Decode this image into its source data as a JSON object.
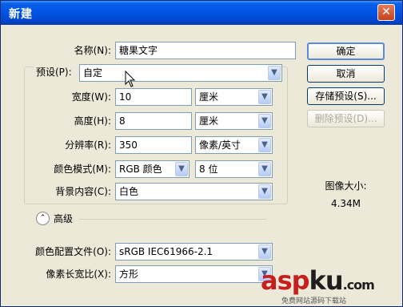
{
  "window": {
    "title": "新建",
    "close_glyph": "✕"
  },
  "form": {
    "name_label": "名称(N):",
    "name_value": "糖果文字",
    "preset_label": "预设(P):",
    "preset_value": "自定",
    "width_label": "宽度(W):",
    "width_value": "10",
    "width_unit": "厘米",
    "height_label": "高度(H):",
    "height_value": "8",
    "height_unit": "厘米",
    "resolution_label": "分辨率(R):",
    "resolution_value": "350",
    "resolution_unit": "像素/英寸",
    "mode_label": "颜色模式(M):",
    "mode_value": "RGB 颜色",
    "depth_value": "8 位",
    "background_label": "背景内容(C):",
    "background_value": "白色",
    "advanced_label": "高级",
    "profile_label": "颜色配置文件(O):",
    "profile_value": "sRGB IEC61966-2.1",
    "aspect_label": "像素长宽比(X):",
    "aspect_value": "方形"
  },
  "buttons": {
    "ok": "确定",
    "cancel": "取消",
    "save_preset": "存储预设(S)...",
    "delete_preset": "删除预设(D)..."
  },
  "image_size": {
    "label": "图像大小:",
    "value": "4.34M"
  },
  "watermark": {
    "logo_left": "asp",
    "logo_right": "ku",
    "logo_suffix": ".com",
    "subtitle": "免费网站源码下载站"
  },
  "icons": {
    "dropdown": "chevron-down-icon",
    "advanced": "collapse-chevrons-icon",
    "cursor": "mouse-pointer-icon",
    "close": "close-icon"
  }
}
